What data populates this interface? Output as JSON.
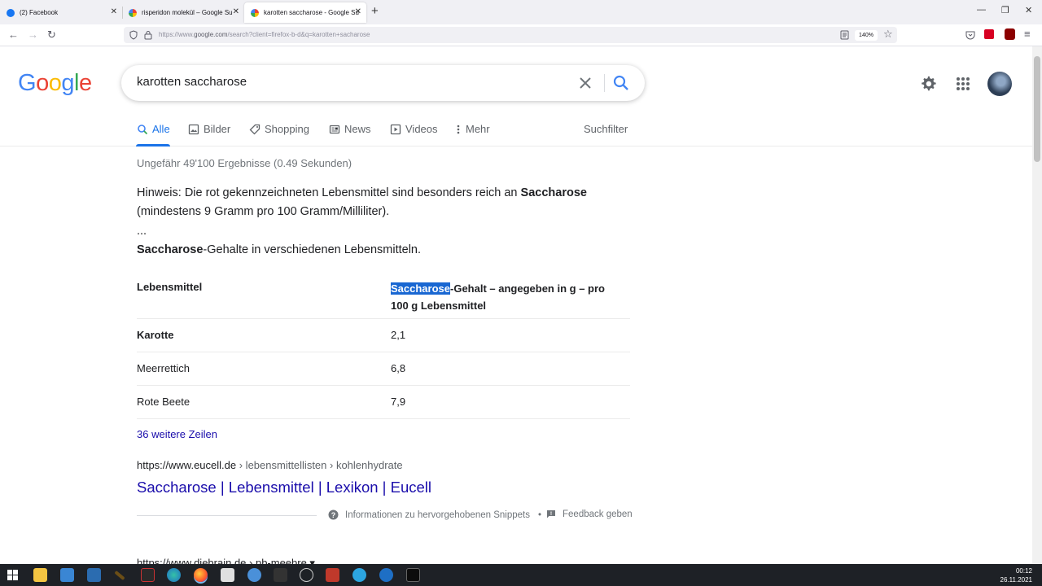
{
  "browser": {
    "tabs": [
      {
        "title": "(2) Facebook",
        "active": false
      },
      {
        "title": "risperidon molekül – Google Su",
        "active": false
      },
      {
        "title": "karotten saccharose - Google Su",
        "active": true
      }
    ],
    "url_prefix": "https://www.",
    "url_domain": "google.com",
    "url_rest": "/search?client=firefox-b-d&q=karotten+sacharose",
    "zoom": "140%"
  },
  "google": {
    "logo": [
      "G",
      "o",
      "o",
      "g",
      "l",
      "e"
    ],
    "query": "karotten saccharose",
    "tabs": [
      "Alle",
      "Bilder",
      "Shopping",
      "News",
      "Videos",
      "Mehr"
    ],
    "tools": "Suchfilter",
    "stats": "Ungefähr 49'100 Ergebnisse (0.49 Sekunden)"
  },
  "snippet": {
    "note_start": "Hinweis: Die rot gekennzeichneten Lebensmittel sind besonders reich an ",
    "note_bold": "Saccharose",
    "note_line2": "(mindestens 9 Gramm pro 100 Gramm/Milliliter).",
    "ellipsis": "...",
    "caption_bold": "Saccharose",
    "caption_rest": "-Gehalte in verschiedenen Lebensmitteln.",
    "table": {
      "header_col1": "Lebensmittel",
      "header_col2_hl": "Saccharose",
      "header_col2_line1": "-Gehalt – angegeben in g – pro",
      "header_col2_line2": "100 g Lebensmittel",
      "rows": [
        {
          "food": "Karotte",
          "value": "2,1"
        },
        {
          "food": "Meerrettich",
          "value": "6,8"
        },
        {
          "food": "Rote Beete",
          "value": "7,9"
        }
      ]
    },
    "more_rows": "36 weitere Zeilen",
    "cite_domain": "https://www.eucell.de",
    "cite_path": " › lebensmittellisten › kohlenhydrate",
    "title": "Saccharose | Lebensmittel | Lexikon | Eucell",
    "about": "Informationen zu hervorgehobenen Snippets",
    "feedback": "Feedback geben"
  },
  "next_result": {
    "cite": "https://www.diebrain.de › pb-meebre ▾"
  },
  "taskbar": {
    "time": "00:12",
    "date": "26.11.2021"
  }
}
